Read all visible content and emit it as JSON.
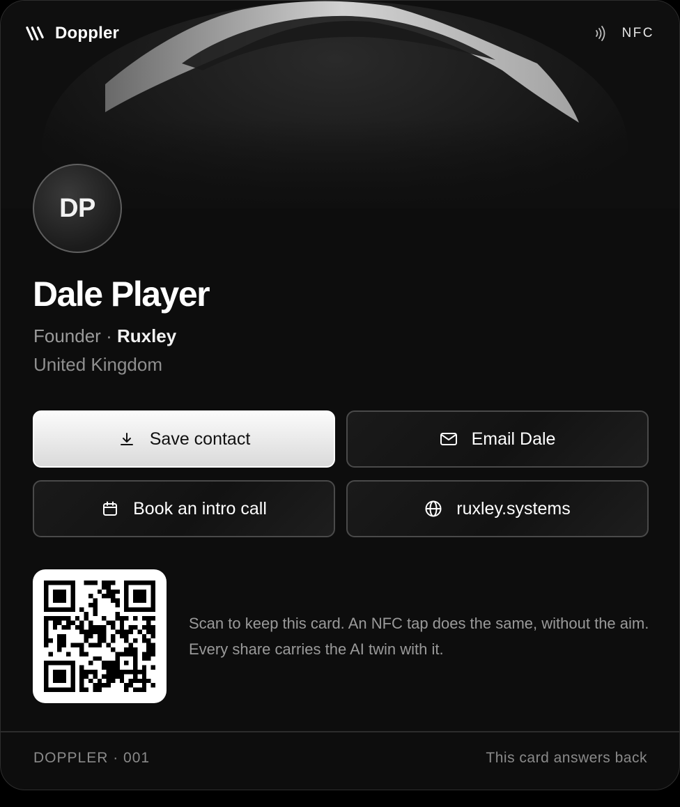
{
  "brand": {
    "name": "Doppler",
    "icon": "doppler-logo-icon"
  },
  "nfc": {
    "label": "NFC",
    "icon": "nfc-waves-icon"
  },
  "profile": {
    "initials": "DP",
    "name": "Dale Player",
    "title": "Founder",
    "separator": " · ",
    "company": "Ruxley",
    "location": "United Kingdom"
  },
  "actions": {
    "save": {
      "label": "Save contact",
      "icon": "download-icon"
    },
    "email": {
      "label": "Email Dale",
      "icon": "envelope-icon"
    },
    "book": {
      "label": "Book an intro call",
      "icon": "calendar-icon"
    },
    "website": {
      "label": "ruxley.systems",
      "icon": "globe-icon"
    }
  },
  "qr": {
    "note": "Scan to keep this card. An NFC tap does the same, without the aim. Every share carries the AI twin with it."
  },
  "footer": {
    "left": "DOPPLER · 001",
    "right": "This card answers back"
  },
  "colors": {
    "background": "#0d0d0d",
    "primary_button": "#e8e8e8",
    "secondary_button_border": "#4a4a4a",
    "muted_text": "#9a9a9a"
  }
}
